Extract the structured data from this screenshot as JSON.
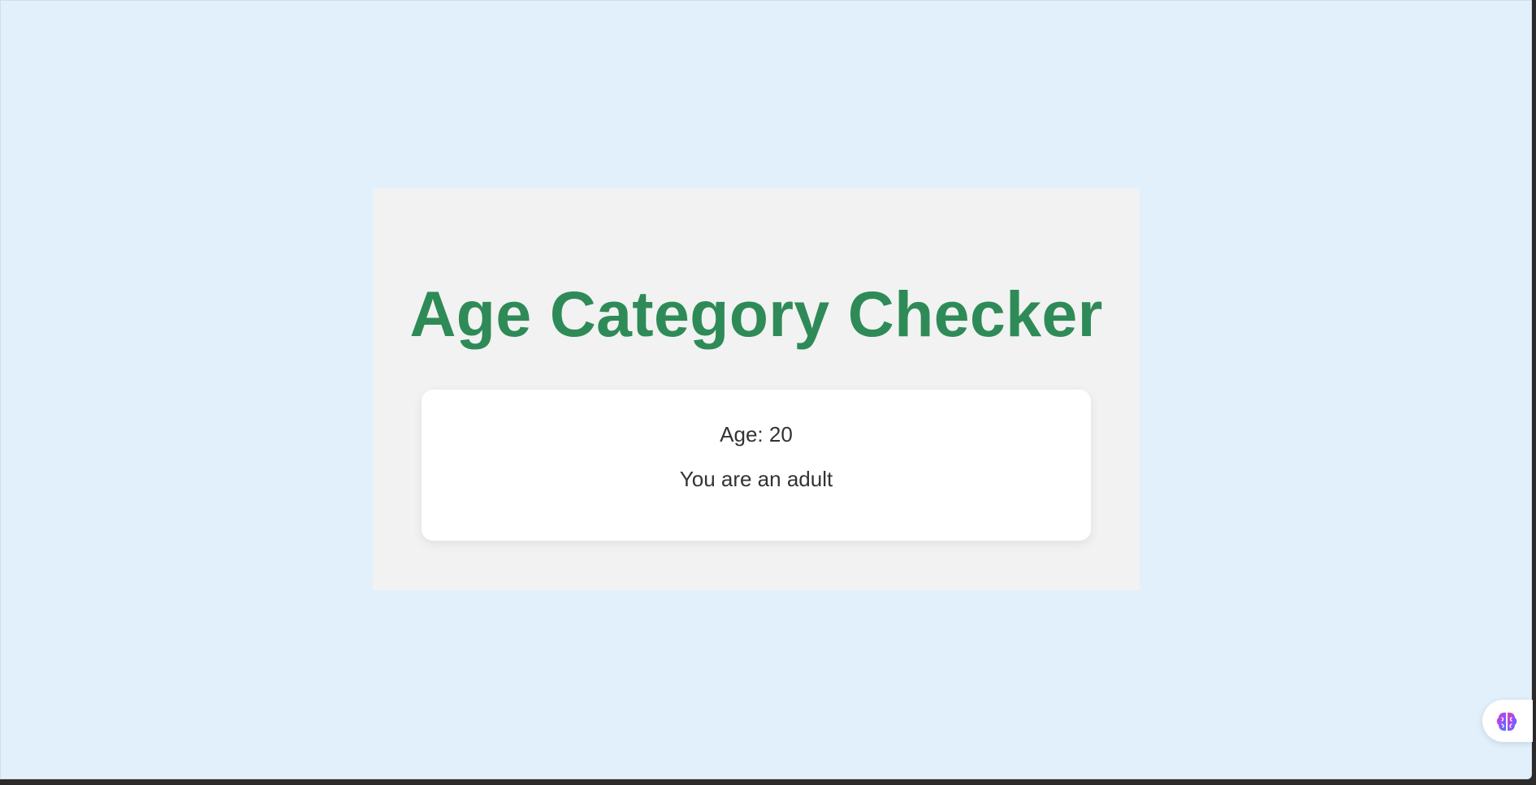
{
  "page": {
    "title": "Age Category Checker"
  },
  "result_card": {
    "age_text": "Age: 20",
    "category_text": "You are an adult"
  },
  "floating_widget": {
    "icon": "brain-icon"
  },
  "colors": {
    "background": "#e2f0fc",
    "panel": "#f2f2f2",
    "title": "#2e8b57",
    "card": "#ffffff",
    "text": "#333333"
  }
}
